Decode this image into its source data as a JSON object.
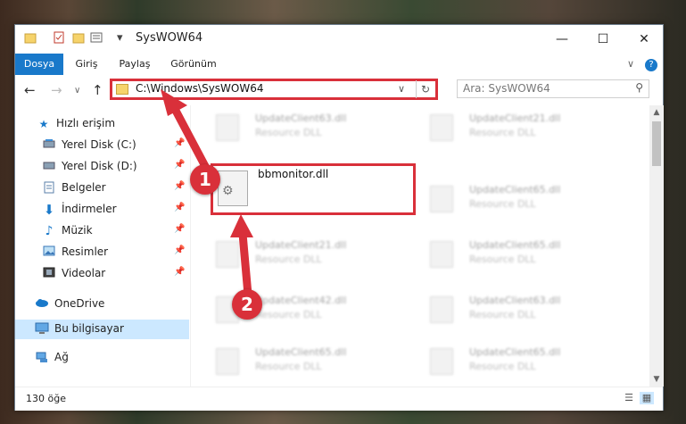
{
  "window": {
    "title": "SysWOW64",
    "quick_access_dropdown": "▾",
    "minimize": "—",
    "maximize": "☐",
    "close": "✕"
  },
  "ribbon": {
    "tabs": [
      {
        "label": "Dosya",
        "active": true
      },
      {
        "label": "Giriş"
      },
      {
        "label": "Paylaş"
      },
      {
        "label": "Görünüm"
      }
    ],
    "expand": "∨",
    "help": "?"
  },
  "navigation": {
    "back": "←",
    "forward": "→",
    "recent": "∨",
    "up": "↑",
    "address": "C:\\Windows\\SysWOW64",
    "address_dropdown": "∨",
    "refresh": "↻",
    "search_placeholder": "Ara: SysWOW64",
    "search_icon": "⚲"
  },
  "sidebar": {
    "quick_access": "Hızlı erişim",
    "items": [
      {
        "label": "Yerel Disk (C:)",
        "icon": "disk-icon"
      },
      {
        "label": "Yerel Disk (D:)",
        "icon": "disk-icon"
      },
      {
        "label": "Belgeler",
        "icon": "documents-icon"
      },
      {
        "label": "İndirmeler",
        "icon": "downloads-icon"
      },
      {
        "label": "Müzik",
        "icon": "music-icon"
      },
      {
        "label": "Resimler",
        "icon": "pictures-icon"
      },
      {
        "label": "Videolar",
        "icon": "videos-icon"
      }
    ],
    "onedrive": "OneDrive",
    "this_pc": "Bu bilgisayar",
    "network": "Ağ"
  },
  "files": {
    "left_column": [
      {
        "name": "UpdateClient63.dll",
        "type": "Resource DLL"
      },
      {
        "name": "UpdateClient21.dll",
        "type": "Resource DLL"
      },
      {
        "name": "UpdateClient42.dll",
        "type": "Resource DLL"
      },
      {
        "name": "UpdateClient65.dll",
        "type": "Resource DLL"
      }
    ],
    "right_column": [
      {
        "name": "UpdateClient21.dll",
        "type": "Resource DLL"
      },
      {
        "name": "UpdateClient65.dll",
        "type": "Resource DLL"
      },
      {
        "name": "UpdateClient65.dll",
        "type": "Resource DLL"
      },
      {
        "name": "UpdateClient63.dll",
        "type": "Resource DLL"
      },
      {
        "name": "UpdateClient65.dll",
        "type": "Resource DLL"
      }
    ],
    "highlighted": {
      "name": "bbmonitor.dll"
    }
  },
  "status": {
    "item_count": "130 öğe"
  },
  "annotations": {
    "step1": "1",
    "step2": "2"
  },
  "colors": {
    "accent": "#1979ca",
    "highlight": "#d9303a"
  }
}
